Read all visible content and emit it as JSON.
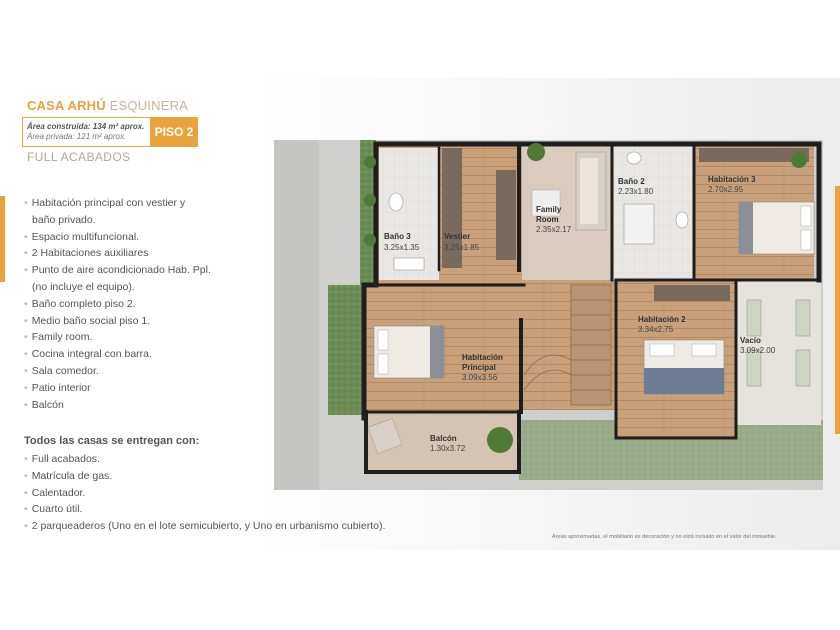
{
  "header": {
    "title_strong": "CASA ARHÚ",
    "title_light": " ESQUINERA",
    "area_built": "Área construida: 134 m² aprox.",
    "area_private": "Área privada: 121 m² aprox.",
    "floor_badge": "PISO 2",
    "finish": "FULL ACABADOS"
  },
  "features": [
    "Habitación principal con vestier y",
    "baño privado.",
    "Espacio multifuncional.",
    "2 Habitaciones auxiliares",
    "Punto de aire acondicionado Hab. Ppl.",
    "(no incluye el equipo).",
    "Baño completo piso 2.",
    "Medio baño social piso 1.",
    "Family room.",
    "Cocina integral con barra.",
    "Sala comedor.",
    "Patio interior",
    "Balcón"
  ],
  "included": {
    "title": "Todos las casas se entregan con:",
    "items": [
      "Full acabados.",
      "Matrícula de gas.",
      "Calentador.",
      "Cuarto útil.",
      "2 parqueaderos (Uno en el lote semicubierto, y Uno en urbanismo cubierto)."
    ]
  },
  "disclaimer": "Áreas aproximadas, el mobiliario es decoración y no está incluido en el valor del inmueble.",
  "rooms": {
    "bano3": {
      "name": "Baño 3",
      "dim": "3.25x1.35"
    },
    "vestier": {
      "name": "Vestier",
      "dim": "3.25x1.85"
    },
    "family": {
      "name1": "Family",
      "name2": "Room",
      "dim": "2.35x2.17"
    },
    "bano2": {
      "name": "Baño 2",
      "dim": "2.23x1.80"
    },
    "hab3": {
      "name": "Habitación 3",
      "dim": "2.70x2.95"
    },
    "hab2": {
      "name": "Habitación 2",
      "dim": "3.34x2.75"
    },
    "vacio": {
      "name": "Vacío",
      "dim": "3.09x2.00"
    },
    "habppl": {
      "name1": "Habitación",
      "name2": "Principal",
      "dim": "3.09x3.56"
    },
    "balcon": {
      "name": "Balcón",
      "dim": "1.30x3.72"
    }
  },
  "colors": {
    "accent": "#e8a33c",
    "wood": "#c9a27a",
    "wall": "#1f1f1f",
    "grass": "#6f8f55"
  }
}
